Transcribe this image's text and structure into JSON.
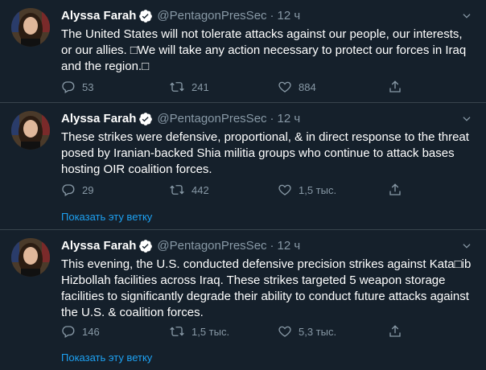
{
  "colors": {
    "background": "#15202b",
    "divider": "#38444d",
    "secondary_text": "#8899a6",
    "link": "#1da1f2",
    "verified": "#ffffff"
  },
  "tweets": [
    {
      "author": "Alyssa Farah",
      "handle": "@PentagonPresSec",
      "dot": "·",
      "time": "12 ч",
      "text": "The United States will not tolerate attacks against our people, our interests, or our allies. □We will take any action necessary to protect our forces in Iraq and the region.□",
      "replies": "53",
      "retweets": "241",
      "likes": "884",
      "show_thread": ""
    },
    {
      "author": "Alyssa Farah",
      "handle": "@PentagonPresSec",
      "dot": "·",
      "time": "12 ч",
      "text": "These strikes were defensive, proportional, & in direct response to the threat posed by Iranian-backed Shia militia groups who continue to attack bases hosting OIR coalition forces.",
      "replies": "29",
      "retweets": "442",
      "likes": "1,5 тыс.",
      "show_thread": "Показать эту ветку"
    },
    {
      "author": "Alyssa Farah",
      "handle": "@PentagonPresSec",
      "dot": "·",
      "time": "12 ч",
      "text": "This evening, the U.S. conducted defensive precision strikes against Kata□ib Hizbollah facilities across Iraq. These strikes targeted 5 weapon storage facilities to significantly degrade their ability to conduct future attacks against the U.S. & coalition forces.",
      "replies": "146",
      "retweets": "1,5 тыс.",
      "likes": "5,3 тыс.",
      "show_thread": "Показать эту ветку"
    }
  ],
  "icons": {
    "verified": "verified-badge-icon",
    "more": "chevron-down-icon",
    "reply": "reply-icon",
    "retweet": "retweet-icon",
    "like": "heart-icon",
    "share": "share-icon"
  }
}
